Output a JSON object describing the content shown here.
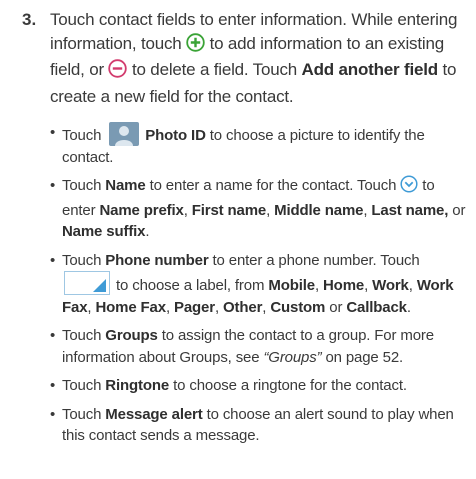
{
  "step": {
    "number": "3.",
    "t1": "Touch contact fields to enter information. While entering information, touch ",
    "t2": " to add information to an existing field, or ",
    "t3": " to delete a field. Touch ",
    "add_field": "Add another field",
    "t4": " to create a new field for the contact."
  },
  "bullets": {
    "dot": "•",
    "photo": {
      "a": "Touch ",
      "b1": "Photo ID",
      "c": " to choose a picture to identify the contact."
    },
    "name": {
      "a": "Touch ",
      "b1": "Name",
      "c": " to enter a name for the contact. Touch ",
      "d": " to enter ",
      "p1": "Name prefix",
      "s1": ", ",
      "p2": "First name",
      "s2": ", ",
      "p3": "Middle name",
      "s3": ", ",
      "p4": "Last name,",
      "s4": " or ",
      "p5": "Name suffix",
      "end": "."
    },
    "phone": {
      "a": "Touch ",
      "b1": "Phone number",
      "c": " to enter a phone number. Touch ",
      "d": " to choose a label, from ",
      "l1": "Mobile",
      "s1": ", ",
      "l2": "Home",
      "s2": ", ",
      "l3": "Work",
      "s3": ", ",
      "l4": "Work Fax",
      "s4": ", ",
      "l5": "Home Fax",
      "s5": ", ",
      "l6": "Pager",
      "s6": ", ",
      "l7": "Other",
      "s7": ", ",
      "l8": "Custom",
      "s8": " or ",
      "l9": "Callback",
      "end": "."
    },
    "groups": {
      "a": "Touch ",
      "b1": "Groups",
      "c": " to assign the contact to a group. For more information about Groups, see ",
      "ref": "“Groups”",
      "d": " on page 52."
    },
    "ringtone": {
      "a": "Touch ",
      "b1": "Ringtone",
      "c": " to choose a ringtone for the contact."
    },
    "alert": {
      "a": "Touch ",
      "b1": "Message alert",
      "c": " to choose an alert sound to play when this contact sends a message."
    }
  },
  "icons": {
    "add": "plus-circle-icon",
    "remove": "minus-circle-icon",
    "expand": "chevron-down-circle-icon",
    "photo": "person-photo-icon",
    "label": "label-selector-icon"
  },
  "colors": {
    "icon_green": "#3aa336",
    "icon_red": "#d23b6d",
    "icon_blue": "#3f9bd6",
    "text": "#3a3a3a"
  }
}
